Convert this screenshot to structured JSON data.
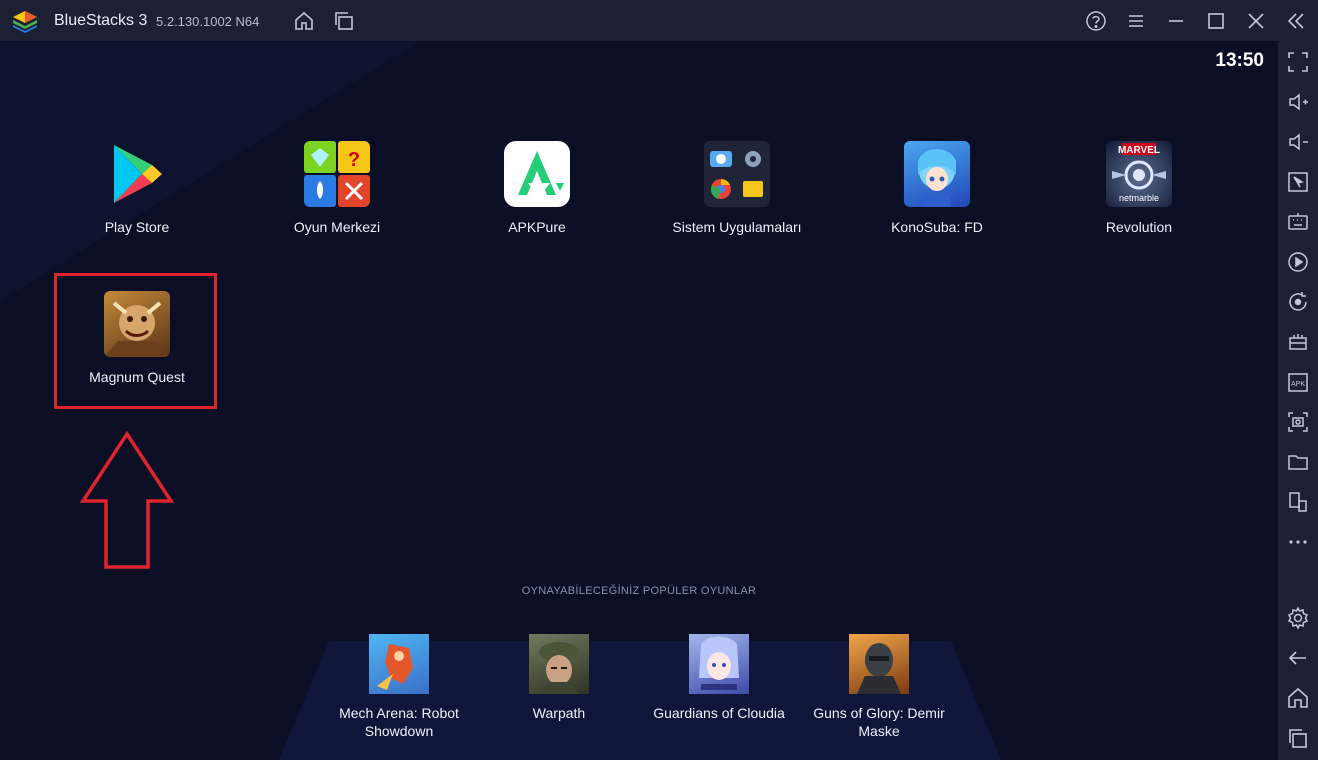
{
  "titlebar": {
    "app_name": "BlueStacks 3",
    "version": "5.2.130.1002",
    "arch": "N64"
  },
  "screen": {
    "clock": "13:50"
  },
  "apps": [
    {
      "label": "Play Store",
      "icon": "play-store-icon"
    },
    {
      "label": "Oyun Merkezi",
      "icon": "game-center-icon"
    },
    {
      "label": "APKPure",
      "icon": "apkpure-icon"
    },
    {
      "label": "Sistem Uygulamaları",
      "icon": "system-apps-icon"
    },
    {
      "label": "KonoSuba: FD",
      "icon": "konosuba-icon"
    },
    {
      "label": "Revolution",
      "icon": "revolution-icon",
      "badge_top": "MARVEL",
      "badge_bottom": "netmarble"
    },
    {
      "label": "Magnum Quest",
      "icon": "magnum-quest-icon"
    }
  ],
  "popular": {
    "title": "OYNAYABİLECEĞİNİZ POPÜLER OYUNLAR",
    "games": [
      {
        "label_line1": "Mech Arena: Robot",
        "label_line2": "Showdown"
      },
      {
        "label_line1": "Warpath",
        "label_line2": ""
      },
      {
        "label_line1": "Guardians of Cloudia",
        "label_line2": ""
      },
      {
        "label_line1": "Guns of Glory: Demir",
        "label_line2": "Maske"
      }
    ]
  },
  "sidebar": {
    "icons": [
      "fullscreen-icon",
      "volume-up-icon",
      "volume-down-icon",
      "cursor-icon",
      "keyboard-icon",
      "macro-record-icon",
      "sync-icon",
      "performance-icon",
      "apk-install-icon",
      "screenshot-icon",
      "folder-icon",
      "multi-instance-icon",
      "more-icon",
      "settings-icon",
      "back-icon",
      "home-icon",
      "recent-apps-icon"
    ]
  },
  "colors": {
    "highlight": "#e0242b",
    "background": "#0b0f26",
    "chrome": "#1b2033"
  }
}
